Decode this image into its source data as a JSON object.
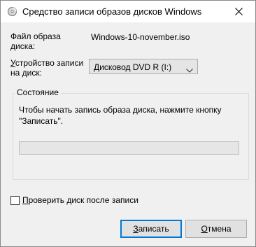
{
  "window": {
    "title": "Средство записи образов дисков Windows"
  },
  "form": {
    "image_file_label": "Файл образа\nдиска:",
    "image_file_value": "Windows-10-november.iso",
    "burner_label_underlined": "У",
    "burner_label_rest": "стройство записи\nна диск:",
    "burner_selected": "Дисковод DVD R (I:)"
  },
  "status": {
    "group_title": "Состояние",
    "text": "Чтобы начать запись образа диска, нажмите кнопку\n\"Записать\".",
    "progress_fraction": 0
  },
  "verify": {
    "checked": false,
    "label_underlined": "П",
    "label_rest": "роверить диск после записи"
  },
  "buttons": {
    "burn_underlined": "З",
    "burn_rest": "аписать",
    "cancel_underlined": "О",
    "cancel_rest": "тмена"
  },
  "icons": {
    "app": "disc-burner-icon",
    "close": "close-icon",
    "dropdown": "chevron-down-icon"
  },
  "colors": {
    "default_button_border": "#0078d7",
    "dialog_background": "#f0f0f0",
    "titlebar_background": "#ffffff"
  }
}
